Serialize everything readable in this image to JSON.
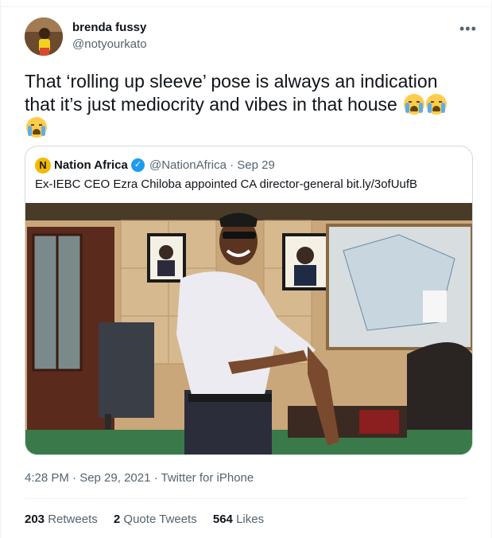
{
  "author": {
    "display_name": "brenda fussy",
    "handle": "@notyourkato",
    "more_icon": "more-horizontal-icon"
  },
  "tweet": {
    "text": "That ‘rolling up sleeve’ pose is always an indication that it’s just mediocrity and vibes in that house",
    "emoji": "loudly-crying-face",
    "emoji_count": 3
  },
  "quoted": {
    "logo_letter": "N",
    "name": "Nation Africa",
    "verified_icon": "verified-badge-icon",
    "handle_date": "@NationAfrica · Sep 29",
    "text": "Ex-IEBC CEO Ezra Chiloba appointed CA director-general bit.ly/3ofUufB"
  },
  "meta": {
    "timestamp": "4:28 PM · Sep 29, 2021 · Twitter for iPhone"
  },
  "stats": {
    "retweets_count": "203",
    "retweets_label": "Retweets",
    "quotes_count": "2",
    "quotes_label": "Quote Tweets",
    "likes_count": "564",
    "likes_label": "Likes"
  },
  "colors": {
    "text": "#0f1419",
    "secondary": "#536471",
    "border": "#cfd9de",
    "verified": "#1d9bf0"
  }
}
